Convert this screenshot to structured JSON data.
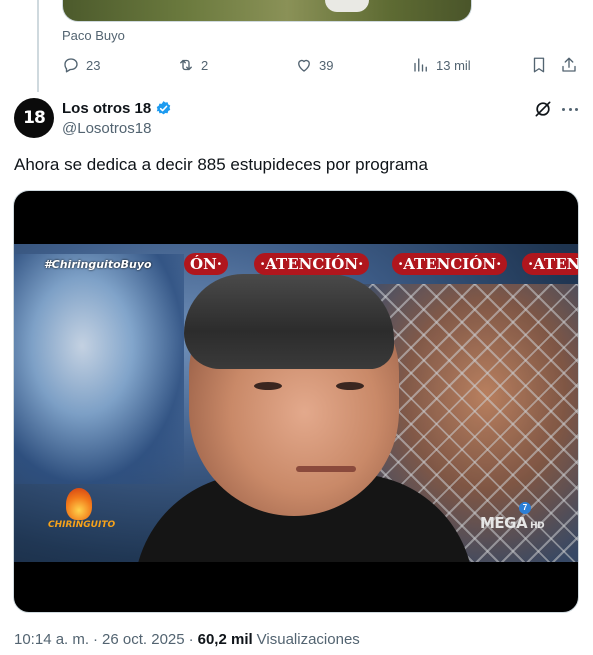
{
  "previous_tweet": {
    "caption": "Paco Buyo",
    "actions": {
      "replies": "23",
      "retweets": "2",
      "likes": "39",
      "views": "13 mil"
    }
  },
  "tweet": {
    "avatar_text": "18",
    "display_name": "Los otros 18",
    "handle": "@Losotros18",
    "text": "Ahora se dedica a decir 885 estupideces por programa",
    "video": {
      "hashtag": "#ChiringuitoBuyo",
      "banners": [
        "ÓN·",
        "·ATENCIÓN·",
        "·ATENCIÓN·",
        "·ATEN"
      ],
      "logo_text": "CHIRINGUITO",
      "channel": "MEGA",
      "channel_suffix": "HD",
      "channel_number": "7"
    },
    "time": "10:14 a. m.",
    "separator": "·",
    "date": "26 oct. 2025",
    "views_count": "60,2 mil",
    "views_label": "Visualizaciones"
  },
  "colors": {
    "text_primary": "#0f1419",
    "text_secondary": "#536471",
    "verified_blue": "#1d9bf0",
    "border": "#cfd9de",
    "banner_red": "#b0161d"
  },
  "icons": [
    "reply-icon",
    "retweet-icon",
    "like-icon",
    "views-icon",
    "bookmark-icon",
    "share-icon",
    "verified-icon",
    "grok-icon",
    "more-icon"
  ]
}
